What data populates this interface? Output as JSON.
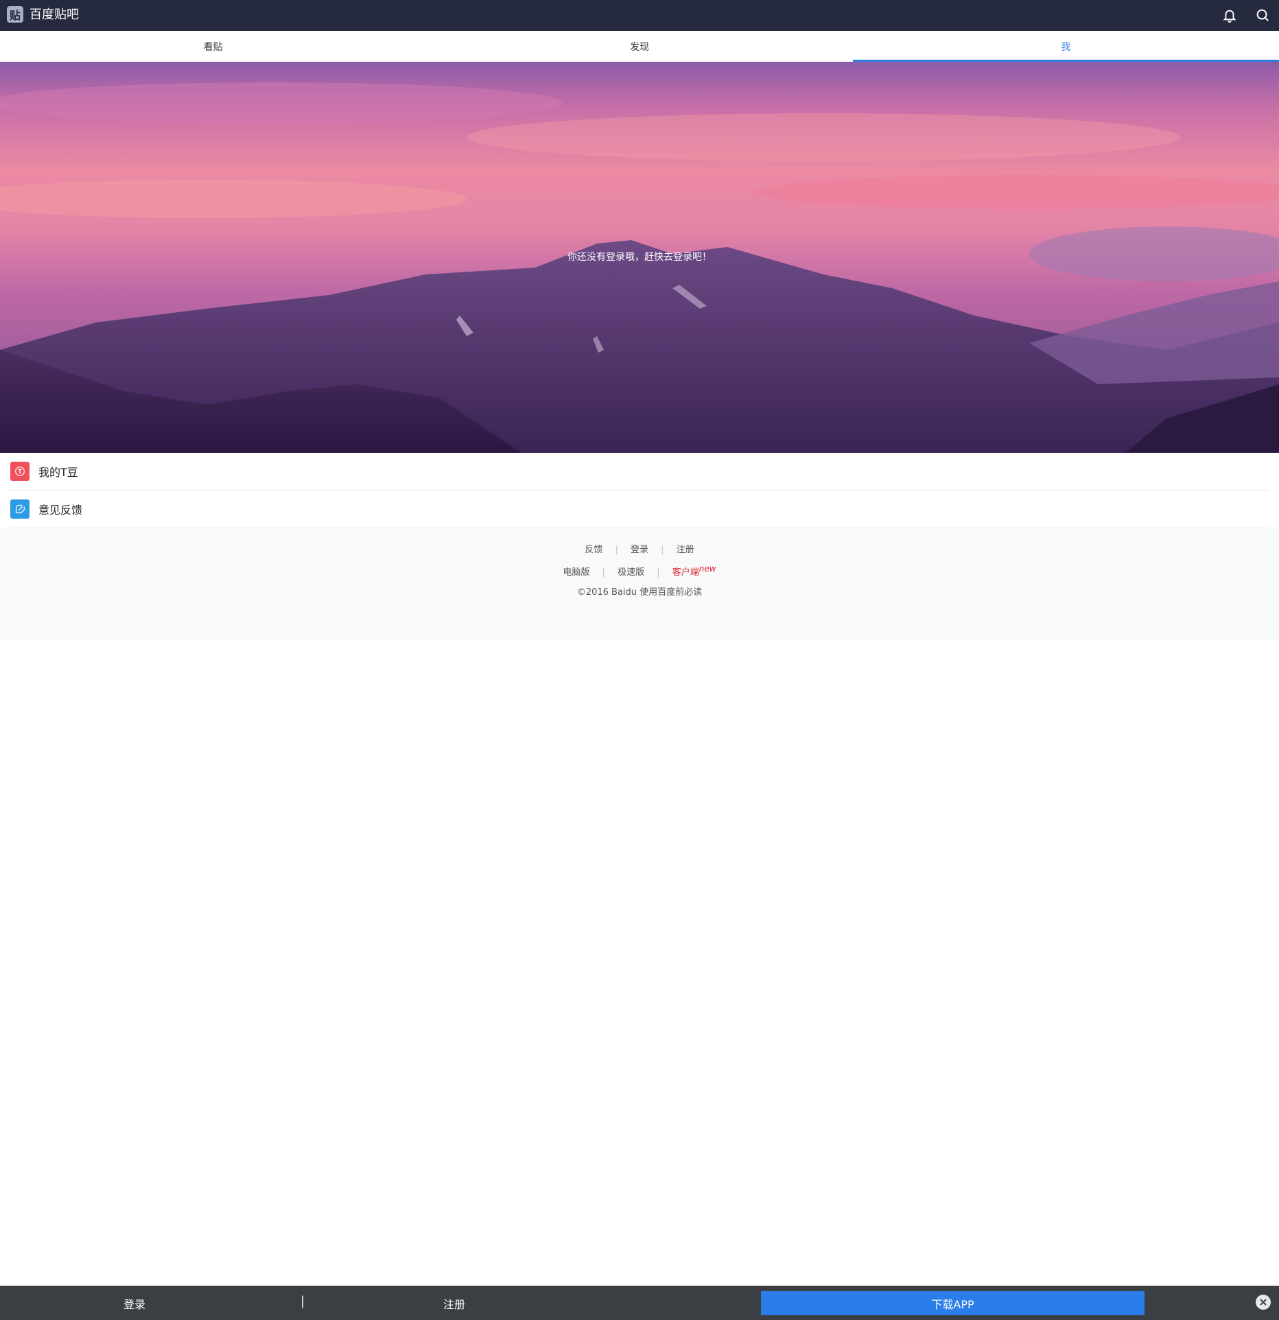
{
  "header": {
    "logo_glyph": "贴",
    "app_title": "百度贴吧",
    "icons": [
      "bell-icon",
      "search-icon"
    ]
  },
  "tabs": [
    {
      "label": "看贴"
    },
    {
      "label": "发现"
    },
    {
      "label": "我",
      "active": true
    }
  ],
  "hero": {
    "message": "你还没有登录哦，赶快去登录吧！"
  },
  "list": [
    {
      "label": "我的T豆",
      "icon": "t-coin-icon",
      "color": "#f0505a"
    },
    {
      "label": "意见反馈",
      "icon": "feedback-icon",
      "color": "#2c9be6"
    }
  ],
  "footer": {
    "row1": [
      "反馈",
      "登录",
      "注册"
    ],
    "row2": {
      "pc": "电脑版",
      "lite": "极速版",
      "client": "客户端",
      "client_badge": "new"
    },
    "copyright": "©2016 Baidu 使用百度前必读"
  },
  "bottom_bar": {
    "login": "登录",
    "divider": "|",
    "register": "注册",
    "download": "下载APP"
  },
  "colors": {
    "header_bg": "#262a3e",
    "accent": "#2d7fe0",
    "download_btn": "#2b7de9",
    "bottom_bar_bg": "#3b3e43"
  }
}
